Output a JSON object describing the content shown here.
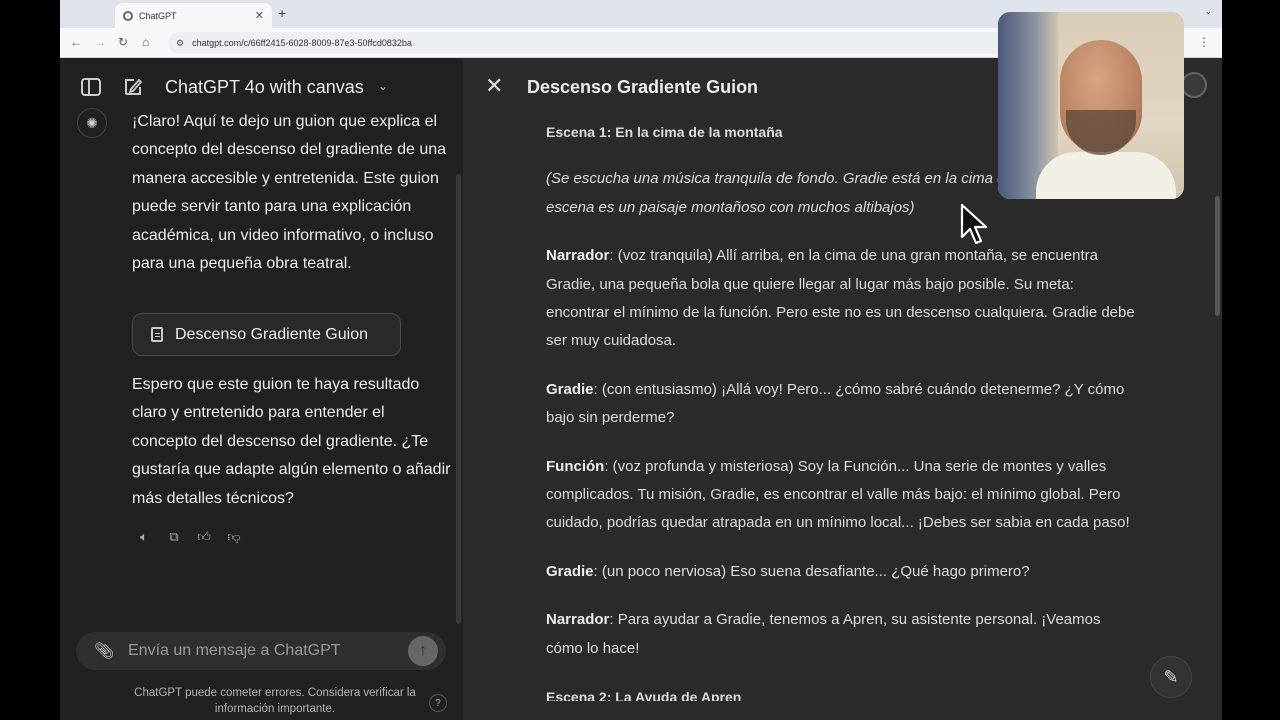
{
  "browser": {
    "tab_title": "ChatGPT",
    "url": "chatgpt.com/c/66ff2415-6028-8009-87e3-50ffcd0832ba"
  },
  "chat": {
    "model_name": "ChatGPT 4o with canvas",
    "message_intro": "¡Claro! Aquí te dejo un guion que explica el concepto del descenso del gradiente de una manera accesible y entretenida. Este guion puede servir tanto para una explicación académica, un video informativo, o incluso para una pequeña obra teatral.",
    "document_chip_label": "Descenso Gradiente Guion",
    "message_outro": "Espero que este guion te haya resultado claro y entretenido para entender el concepto del descenso del gradiente. ¿Te gustaría que adapte algún elemento o añadir más detalles técnicos?",
    "composer_placeholder": "Envía un mensaje a ChatGPT",
    "disclaimer": "ChatGPT puede cometer errores. Considera verificar la información importante.",
    "help_label": "?"
  },
  "canvas": {
    "title": "Descenso Gradiente Guion",
    "scene1": "Escena 1: En la cima de la montaña",
    "stage_direction": "(Se escucha una música tranquila de fondo. Gradie está en la cima de una colina. La escena es un paisaje montañoso con muchos altibajos)",
    "lines": [
      {
        "speaker": "Narrador",
        "text": ": (voz tranquila) Allí arriba, en la cima de una gran montaña, se encuentra Gradie, una pequeña bola que quiere llegar al lugar más bajo posible. Su meta: encontrar el mínimo de la función. Pero este no es un descenso cualquiera. Gradie debe ser muy cuidadosa."
      },
      {
        "speaker": "Gradie",
        "text": ": (con entusiasmo) ¡Allá voy! Pero... ¿cómo sabré cuándo detenerme? ¿Y cómo bajo sin perderme?"
      },
      {
        "speaker": "Función",
        "text": ": (voz profunda y misteriosa) Soy la Función... Una serie de montes y valles complicados. Tu misión, Gradie, es encontrar el valle más bajo: el mínimo global. Pero cuidado, podrías quedar atrapada en un mínimo local... ¡Debes ser sabia en cada paso!"
      },
      {
        "speaker": "Gradie",
        "text": ": (un poco nerviosa) Eso suena desafiante... ¿Qué hago primero?"
      },
      {
        "speaker": "Narrador",
        "text": ": Para ayudar a Gradie, tenemos a Apren, su asistente personal. ¡Veamos cómo lo hace!"
      }
    ],
    "scene2_partial": "Escena 2: La Ayuda de Apren"
  }
}
